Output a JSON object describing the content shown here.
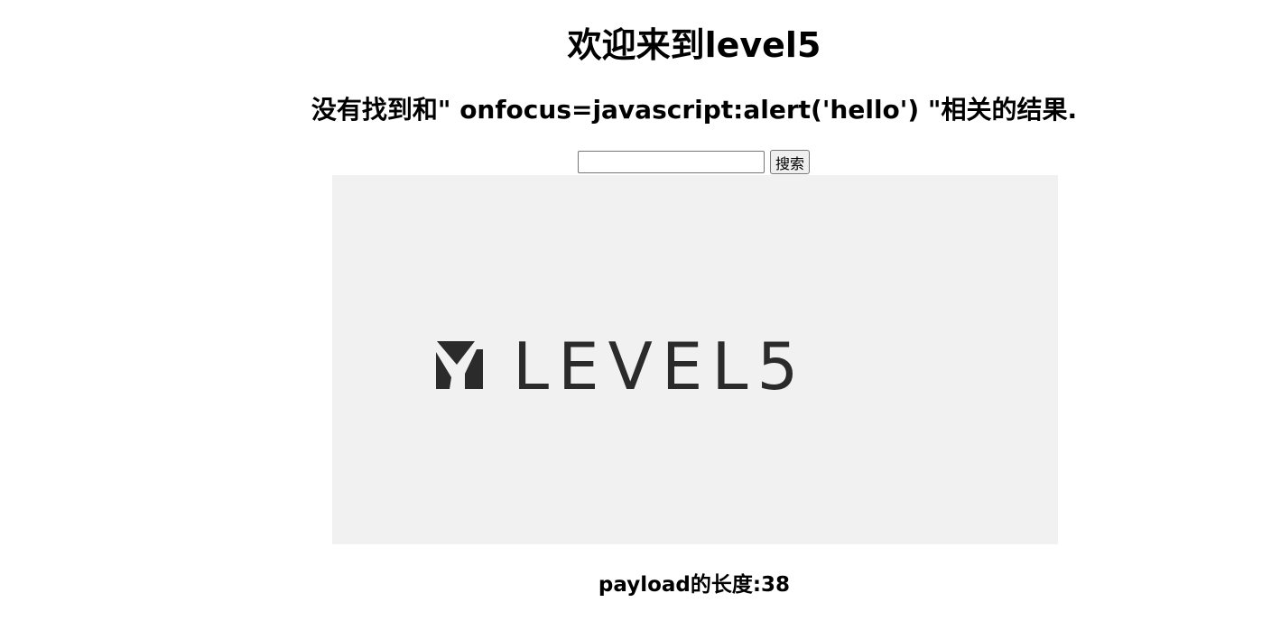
{
  "heading": {
    "welcome": "欢迎来到level5",
    "result_message": "没有找到和\" onfocus=javascript:alert('hello') \"相关的结果."
  },
  "search": {
    "input_value": "",
    "button_label": "搜索"
  },
  "banner": {
    "logo_text": "LEVEL5",
    "background_color": "#f1f1f1",
    "logo_color": "#2b2b2b"
  },
  "footer": {
    "payload_length": "payload的长度:38"
  }
}
